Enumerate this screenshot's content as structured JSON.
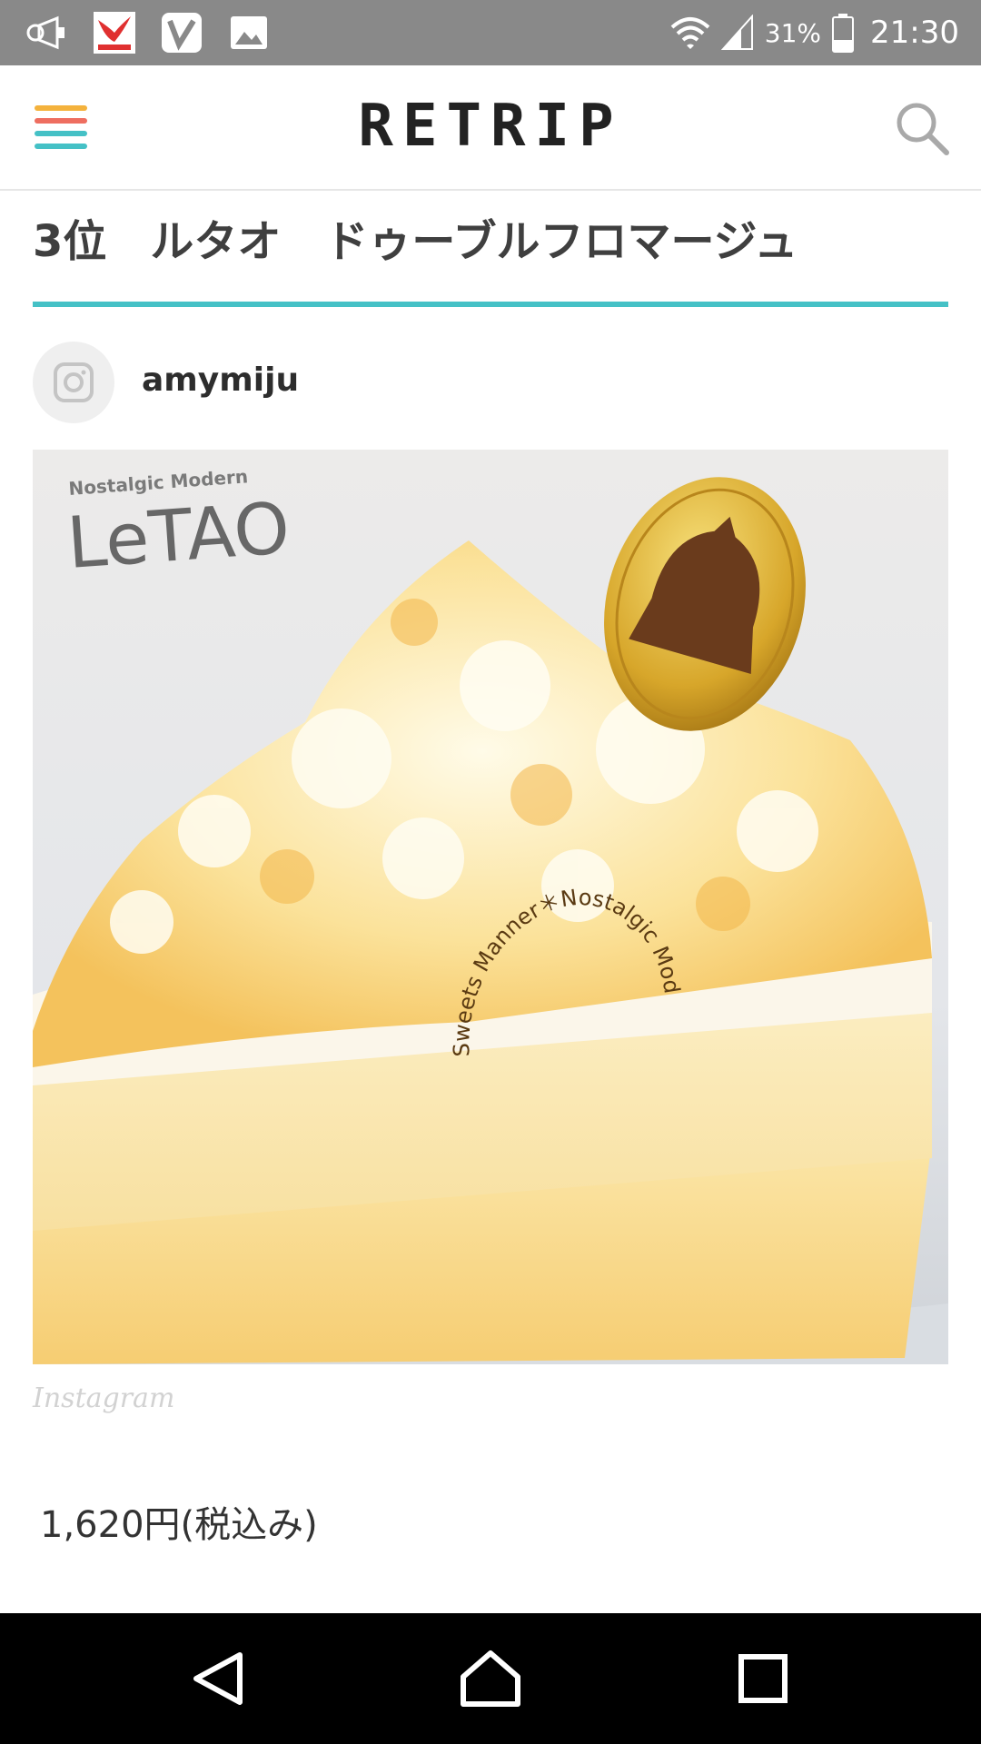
{
  "status_bar": {
    "battery_percent": "31%",
    "time": "21:30",
    "left_icons": [
      "megaphone-icon",
      "iy-card-app-icon",
      "v-app-icon",
      "image-icon"
    ],
    "right_icons": [
      "wifi-icon",
      "cellular-signal-icon",
      "battery-icon"
    ]
  },
  "header": {
    "brand": "RETRIP",
    "menu_icon": "hamburger-menu-icon",
    "menu_colors": [
      "#f4b23c",
      "#ee6e60",
      "#45c1c6",
      "#45c1c6"
    ],
    "search_icon": "search-icon"
  },
  "article": {
    "heading": "3位　ルタオ　ドゥーブルフロマージュ",
    "accent_color": "#45c1c6",
    "source": {
      "platform_icon": "instagram-icon",
      "username": "amymiju"
    },
    "photo": {
      "box_text": "LeTAO",
      "box_small_text": "Nostalgic Modern",
      "medallion_text": "Sweets Manner＊Nostalgic Modern"
    },
    "photo_caption": "Instagram",
    "price": "1,620円(税込み)"
  },
  "nav_bar": {
    "back_icon": "back-triangle-icon",
    "home_icon": "home-icon",
    "recents_icon": "recents-square-icon"
  }
}
